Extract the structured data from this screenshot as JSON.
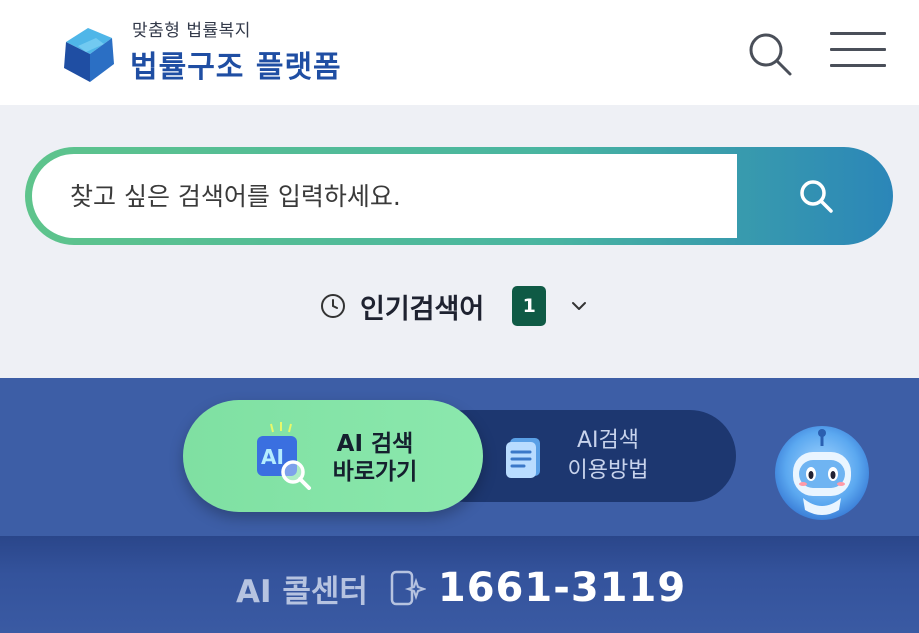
{
  "header": {
    "logo_subtitle": "맞춤형 법률복지",
    "logo_title": "법률구조 플랫폼"
  },
  "search": {
    "placeholder": "찾고 싶은 검색어를 입력하세요."
  },
  "popular": {
    "label": "인기검색어",
    "rank": "1"
  },
  "ai": {
    "go_line1": "AI 검색",
    "go_line2": "바로가기",
    "go_icon_text": "AI",
    "howto_line1": "AI검색",
    "howto_line2": "이용방법"
  },
  "callcenter": {
    "label": "AI 콜센터",
    "number": "1661-3119"
  },
  "colors": {
    "brand_blue": "#1f4ea3",
    "search_green": "#5ec48c",
    "badge_green": "#0f5a45",
    "panel_blue": "#3d5ea6",
    "ai_button_green": "#8be8ad"
  }
}
